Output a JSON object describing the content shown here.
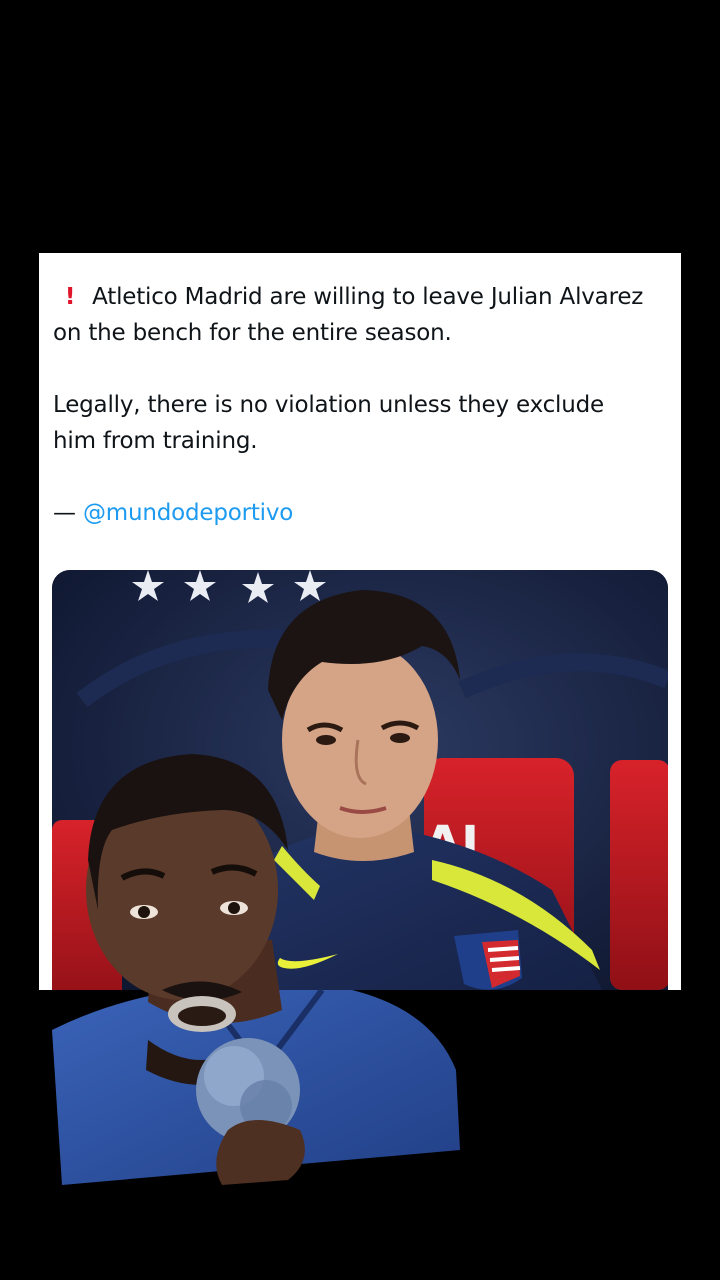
{
  "tweet": {
    "alert_icon": "!",
    "line1": "Atletico Madrid are willing to leave Julian Alvarez",
    "line2": "on the bench for the entire season.",
    "line3": "Legally, there is no violation unless they exclude",
    "line4": "him from training.",
    "dash": "—",
    "source_handle": "@mundodeportivo"
  },
  "photo": {
    "seat_lettering": "AI",
    "subject": "player-on-bench",
    "icons": [
      "star-icon",
      "nike-swoosh-icon",
      "club-crest-icon"
    ]
  },
  "webcam": {
    "subject": "presenter-with-microphone",
    "icons": [
      "microphone-icon"
    ]
  },
  "colors": {
    "background": "#000000",
    "card": "#ffffff",
    "text": "#0f1419",
    "mention": "#1d9bf0",
    "alert": "#e0142b"
  }
}
